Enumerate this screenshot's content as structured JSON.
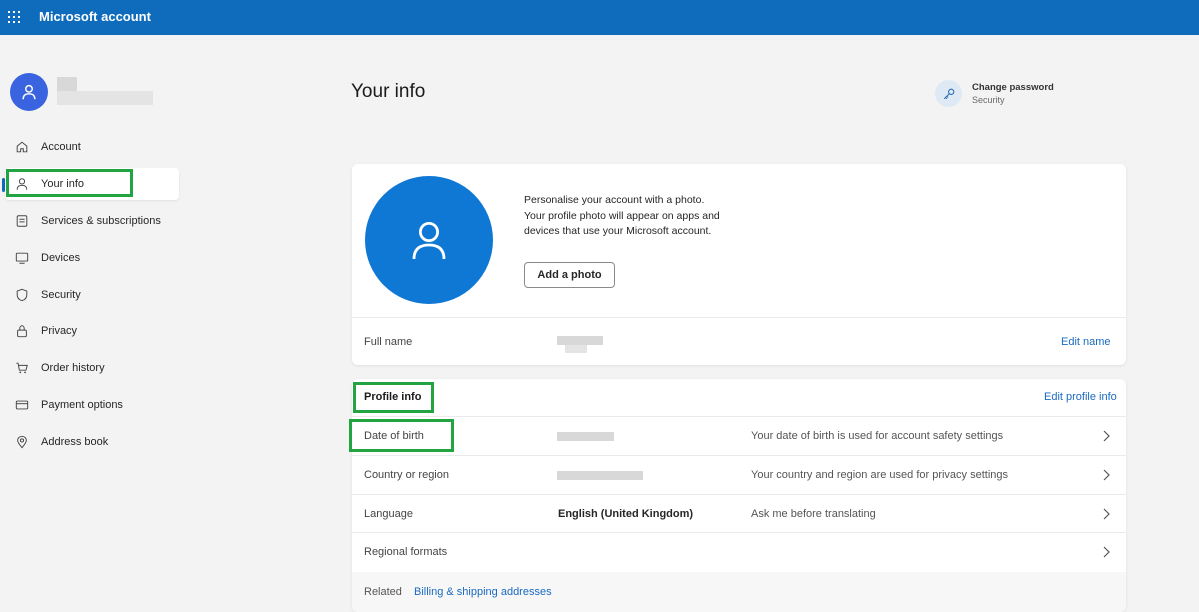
{
  "header": {
    "app_title": "Microsoft account",
    "menu_icon": "waffle-icon"
  },
  "sidebar": {
    "items": [
      {
        "label": "Account",
        "icon": "home-icon"
      },
      {
        "label": "Your info",
        "icon": "person-icon",
        "active": true
      },
      {
        "label": "Services & subscriptions",
        "icon": "list-icon"
      },
      {
        "label": "Devices",
        "icon": "monitor-icon"
      },
      {
        "label": "Security",
        "icon": "shield-icon"
      },
      {
        "label": "Privacy",
        "icon": "lock-icon"
      },
      {
        "label": "Order history",
        "icon": "cart-icon"
      },
      {
        "label": "Payment options",
        "icon": "card-icon"
      },
      {
        "label": "Address book",
        "icon": "location-icon"
      }
    ]
  },
  "main": {
    "title": "Your info",
    "change_password": {
      "title": "Change password",
      "subtitle": "Security",
      "icon": "key-icon"
    },
    "photo": {
      "description": "Personalise your account with a photo. Your profile photo will appear on apps and devices that use your Microsoft account.",
      "add_button": "Add a photo"
    },
    "full_name": {
      "label": "Full name",
      "edit_link": "Edit name"
    },
    "profile_info": {
      "title": "Profile info",
      "edit_link": "Edit profile info",
      "rows": [
        {
          "label": "Date of birth",
          "value": "",
          "description": "Your date of birth is used for account safety settings"
        },
        {
          "label": "Country or region",
          "value": "",
          "description": "Your country and region are used for privacy settings"
        },
        {
          "label": "Language",
          "value": "English (United Kingdom)",
          "description": "Ask me before translating"
        },
        {
          "label": "Regional formats",
          "value": "",
          "description": ""
        }
      ],
      "related_label": "Related",
      "related_link": "Billing & shipping addresses"
    }
  },
  "colors": {
    "brand": "#0f6cbd",
    "avatar": "#0f78d4",
    "highlight": "#22a443",
    "link": "#1a6ac0"
  }
}
